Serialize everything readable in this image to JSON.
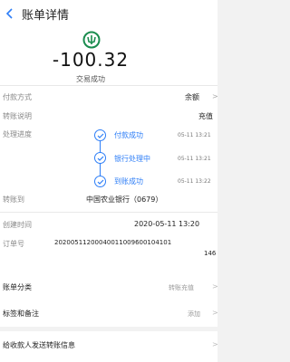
{
  "header": {
    "title": "账单详情"
  },
  "summary": {
    "amount": "-100.32",
    "status": "交易成功"
  },
  "details": {
    "payment_method": {
      "label": "付款方式",
      "value": "余额"
    },
    "transfer_note": {
      "label": "转账说明",
      "value": "充值"
    },
    "progress": {
      "label": "处理进度",
      "steps": [
        {
          "label": "付款成功",
          "time": "05-11 13:21"
        },
        {
          "label": "银行处理中",
          "time": "05-11 13:21"
        },
        {
          "label": "到账成功",
          "time": "05-11 13:22"
        }
      ]
    },
    "transfer_to": {
      "label": "转账到",
      "value": "中国农业银行（0679）"
    },
    "created_time": {
      "label": "创建时间",
      "value": "2020-05-11 13:20"
    },
    "order_no": {
      "label": "订单号",
      "line1": "20200511200040011009600104101",
      "line2": "146"
    }
  },
  "rows": {
    "category": {
      "label": "账单分类",
      "value": "转账充值"
    },
    "tags": {
      "label": "标签和备注",
      "value": "添加"
    },
    "message": {
      "label": "给收款人发送转账信息"
    }
  },
  "colors": {
    "accent": "#2d7ef7",
    "logo_green": "#1a8c4e"
  }
}
